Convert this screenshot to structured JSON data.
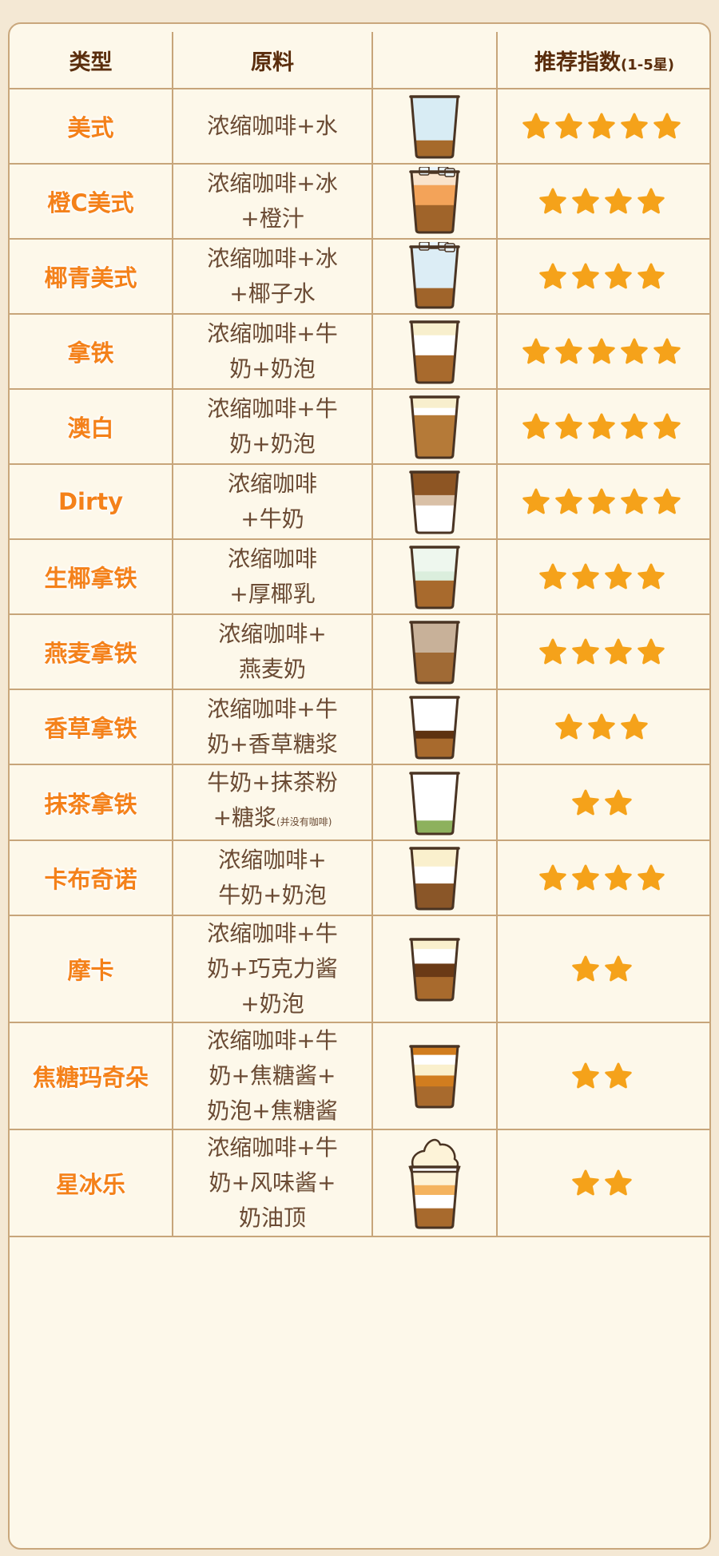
{
  "header": {
    "type": "类型",
    "ingredients": "原料",
    "image": "",
    "rating_main": "推荐指数",
    "rating_range": "(1-5星)"
  },
  "colors": {
    "accent": "#f4811a",
    "star": "#f5a21a",
    "border": "#c7a57a",
    "header_text": "#5a2d0c",
    "body_text": "#6a4a33"
  },
  "rows": [
    {
      "name": "美式",
      "ingredients": [
        "浓缩咖啡+水"
      ],
      "note": "",
      "rating": 5,
      "cup": "americano-cup-icon"
    },
    {
      "name": "橙C美式",
      "ingredients": [
        "浓缩咖啡+冰",
        "+橙汁"
      ],
      "note": "",
      "rating": 4,
      "cup": "orange-americano-cup-icon"
    },
    {
      "name": "椰青美式",
      "ingredients": [
        "浓缩咖啡+冰",
        "+椰子水"
      ],
      "note": "",
      "rating": 4,
      "cup": "coconut-americano-cup-icon"
    },
    {
      "name": "拿铁",
      "ingredients": [
        "浓缩咖啡+牛",
        "奶+奶泡"
      ],
      "note": "",
      "rating": 5,
      "cup": "latte-cup-icon"
    },
    {
      "name": "澳白",
      "ingredients": [
        "浓缩咖啡+牛",
        "奶+奶泡"
      ],
      "note": "",
      "rating": 5,
      "cup": "flat-white-cup-icon"
    },
    {
      "name": "Dirty",
      "ingredients": [
        "浓缩咖啡",
        "+牛奶"
      ],
      "note": "",
      "rating": 5,
      "cup": "dirty-cup-icon"
    },
    {
      "name": "生椰拿铁",
      "ingredients": [
        "浓缩咖啡",
        "+厚椰乳"
      ],
      "note": "",
      "rating": 4,
      "cup": "coconut-latte-cup-icon"
    },
    {
      "name": "燕麦拿铁",
      "ingredients": [
        "浓缩咖啡+",
        "燕麦奶"
      ],
      "note": "",
      "rating": 4,
      "cup": "oat-latte-cup-icon"
    },
    {
      "name": "香草拿铁",
      "ingredients": [
        "浓缩咖啡+牛",
        "奶+香草糖浆"
      ],
      "note": "",
      "rating": 3,
      "cup": "vanilla-latte-cup-icon"
    },
    {
      "name": "抹茶拿铁",
      "ingredients": [
        "牛奶+抹茶粉",
        "+糖浆"
      ],
      "note": "(并没有咖啡)",
      "rating": 2,
      "cup": "matcha-latte-cup-icon"
    },
    {
      "name": "卡布奇诺",
      "ingredients": [
        "浓缩咖啡+",
        "牛奶+奶泡"
      ],
      "note": "",
      "rating": 4,
      "cup": "cappuccino-cup-icon"
    },
    {
      "name": "摩卡",
      "ingredients": [
        "浓缩咖啡+牛",
        "奶+巧克力酱",
        "+奶泡"
      ],
      "note": "",
      "rating": 2,
      "cup": "mocha-cup-icon"
    },
    {
      "name": "焦糖玛奇朵",
      "ingredients": [
        "浓缩咖啡+牛",
        "奶+焦糖酱+",
        "奶泡+焦糖酱"
      ],
      "note": "",
      "rating": 2,
      "cup": "caramel-macchiato-cup-icon"
    },
    {
      "name": "星冰乐",
      "ingredients": [
        "浓缩咖啡+牛",
        "奶+风味酱+",
        "奶油顶"
      ],
      "note": "",
      "rating": 2,
      "cup": "frappuccino-cup-icon"
    }
  ]
}
